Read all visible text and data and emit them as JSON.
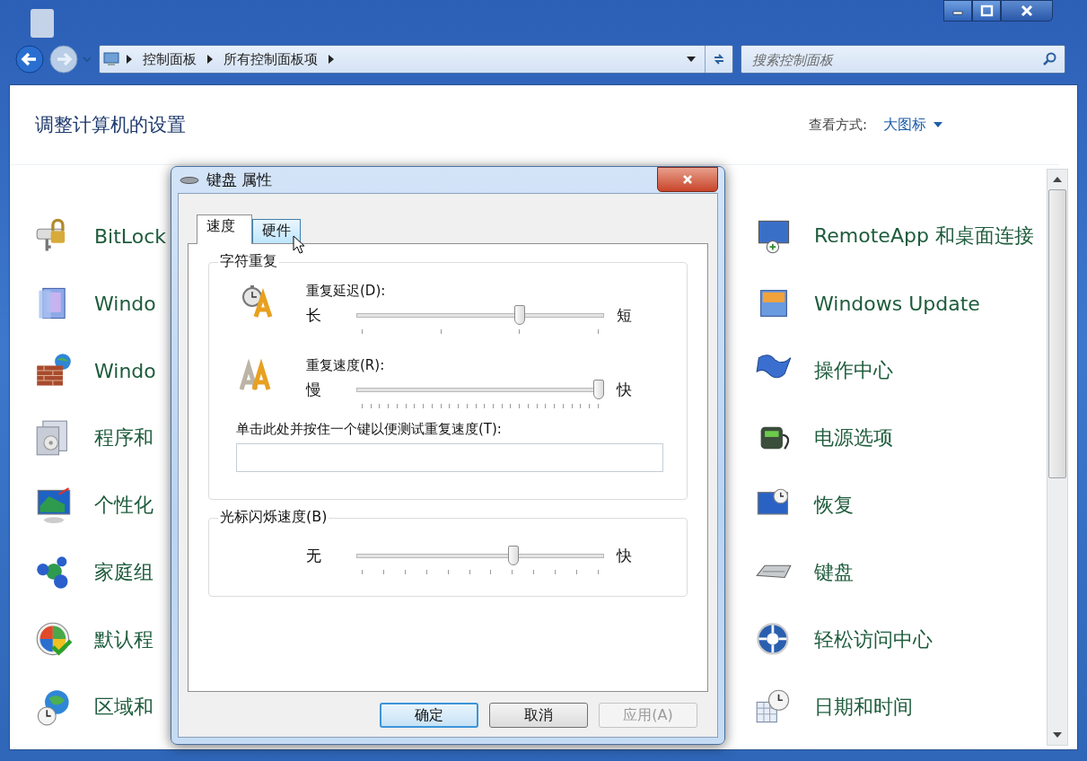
{
  "address_bar": {
    "breadcrumbs": [
      "控制面板",
      "所有控制面板项"
    ]
  },
  "search": {
    "placeholder": "搜索控制面板"
  },
  "header": {
    "title": "调整计算机的设置",
    "view_label": "查看方式:",
    "view_value": "大图标"
  },
  "columns": [
    [
      {
        "label": "BitLock"
      },
      {
        "label": "Windo"
      },
      {
        "label": "Windo"
      },
      {
        "label": "程序和"
      },
      {
        "label": "个性化"
      },
      {
        "label": "家庭组"
      },
      {
        "label": "默认程"
      },
      {
        "label": "区域和"
      }
    ],
    [
      {
        "label": "RemoteApp 和桌面连接"
      },
      {
        "label": "Windows Update"
      },
      {
        "label": "操作中心"
      },
      {
        "label": "电源选项"
      },
      {
        "label": "恢复"
      },
      {
        "label": "键盘"
      },
      {
        "label": "轻松访问中心"
      },
      {
        "label": "日期和时间"
      }
    ]
  ],
  "dialog": {
    "title": "键盘 属性",
    "tabs": [
      {
        "label": "速度",
        "selected": true,
        "hovered": false
      },
      {
        "label": "硬件",
        "selected": false,
        "hovered": true
      }
    ],
    "groups": [
      {
        "title": "字符重复",
        "sliders": [
          {
            "label": "重复延迟(D):",
            "min_label": "长",
            "max_label": "短",
            "level": 0.667
          },
          {
            "label": "重复速度(R):",
            "min_label": "慢",
            "max_label": "快",
            "level": 1
          }
        ],
        "test_field": {
          "label": "单击此处并按住一个键以便测试重复速度(T):"
        }
      },
      {
        "title": "光标闪烁速度(B)",
        "sliders": [
          {
            "min_label": "无",
            "max_label": "快",
            "level": 0.64
          }
        ]
      }
    ],
    "buttons": [
      {
        "label": "确定",
        "default": true,
        "disabled": false
      },
      {
        "label": "取消",
        "default": false,
        "disabled": false
      },
      {
        "label": "应用(A)",
        "default": false,
        "disabled": true
      }
    ]
  }
}
